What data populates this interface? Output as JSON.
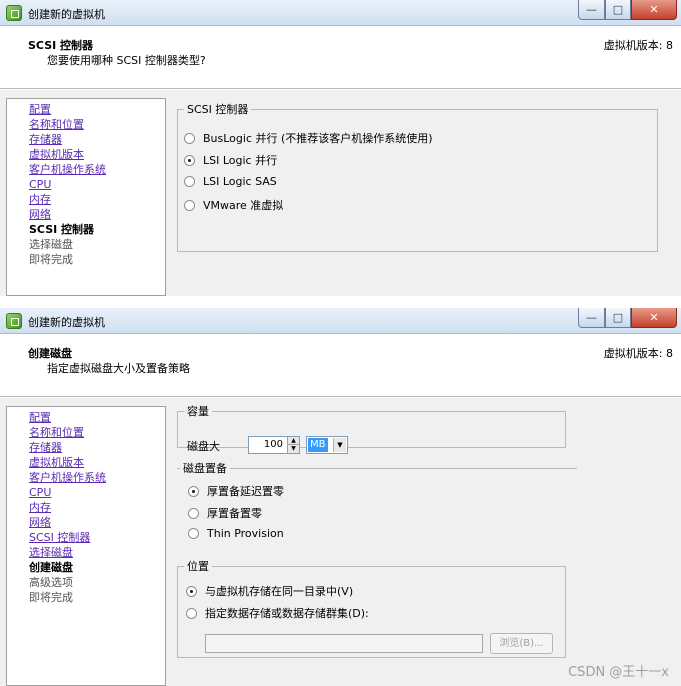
{
  "screen1": {
    "window_title": "创建新的虚拟机",
    "header_title": "SCSI 控制器",
    "header_subtitle": "您要使用哪种 SCSI 控制器类型?",
    "version_label": "虚拟机版本: 8",
    "nav_items": [
      {
        "label": "配置",
        "state": "link"
      },
      {
        "label": "名称和位置",
        "state": "link"
      },
      {
        "label": "存储器",
        "state": "link"
      },
      {
        "label": "虚拟机版本",
        "state": "link"
      },
      {
        "label": "客户机操作系统",
        "state": "link"
      },
      {
        "label": "CPU",
        "state": "link"
      },
      {
        "label": "内存",
        "state": "link"
      },
      {
        "label": "网络",
        "state": "link"
      },
      {
        "label": "SCSI 控制器",
        "state": "current"
      },
      {
        "label": "选择磁盘",
        "state": "pending"
      },
      {
        "label": "即将完成",
        "state": "pending"
      }
    ],
    "group_title": "SCSI 控制器",
    "options": [
      {
        "label": "BusLogic 并行 (不推荐该客户机操作系统使用)",
        "selected": false
      },
      {
        "label": "LSI Logic 并行",
        "selected": true
      },
      {
        "label": "LSI Logic SAS",
        "selected": false
      },
      {
        "label": "VMware 准虚拟",
        "selected": false
      }
    ]
  },
  "screen2": {
    "window_title": "创建新的虚拟机",
    "header_title": "创建磁盘",
    "header_subtitle": "指定虚拟磁盘大小及置备策略",
    "version_label": "虚拟机版本: 8",
    "nav_items": [
      {
        "label": "配置",
        "state": "link"
      },
      {
        "label": "名称和位置",
        "state": "link"
      },
      {
        "label": "存储器",
        "state": "link"
      },
      {
        "label": "虚拟机版本",
        "state": "link"
      },
      {
        "label": "客户机操作系统",
        "state": "link"
      },
      {
        "label": "CPU",
        "state": "link"
      },
      {
        "label": "内存",
        "state": "link"
      },
      {
        "label": "网络",
        "state": "link"
      },
      {
        "label": "SCSI 控制器",
        "state": "link"
      },
      {
        "label": "选择磁盘",
        "state": "link"
      },
      {
        "label": "创建磁盘",
        "state": "current"
      },
      {
        "label": "高级选项",
        "state": "pending"
      },
      {
        "label": "即将完成",
        "state": "pending"
      }
    ],
    "capacity": {
      "title": "容量",
      "size_label": "磁盘大",
      "size_value": "100",
      "unit_value": "MB"
    },
    "provisioning": {
      "title": "磁盘置备",
      "options": [
        {
          "label": "厚置备延迟置零",
          "selected": true
        },
        {
          "label": "厚置备置零",
          "selected": false
        },
        {
          "label": "Thin Provision",
          "selected": false
        }
      ]
    },
    "location": {
      "title": "位置",
      "options": [
        {
          "label": "与虚拟机存储在同一目录中(V)",
          "selected": true
        },
        {
          "label": "指定数据存储或数据存储群集(D):",
          "selected": false
        }
      ],
      "path_value": "",
      "browse_label": "浏览(B)..."
    }
  },
  "watermark": "CSDN @王十一x",
  "colors": {
    "link": "#5a2ab4",
    "selection": "#3399ff",
    "titlebar": "#cfdff0",
    "panel": "#f0f0f0"
  }
}
